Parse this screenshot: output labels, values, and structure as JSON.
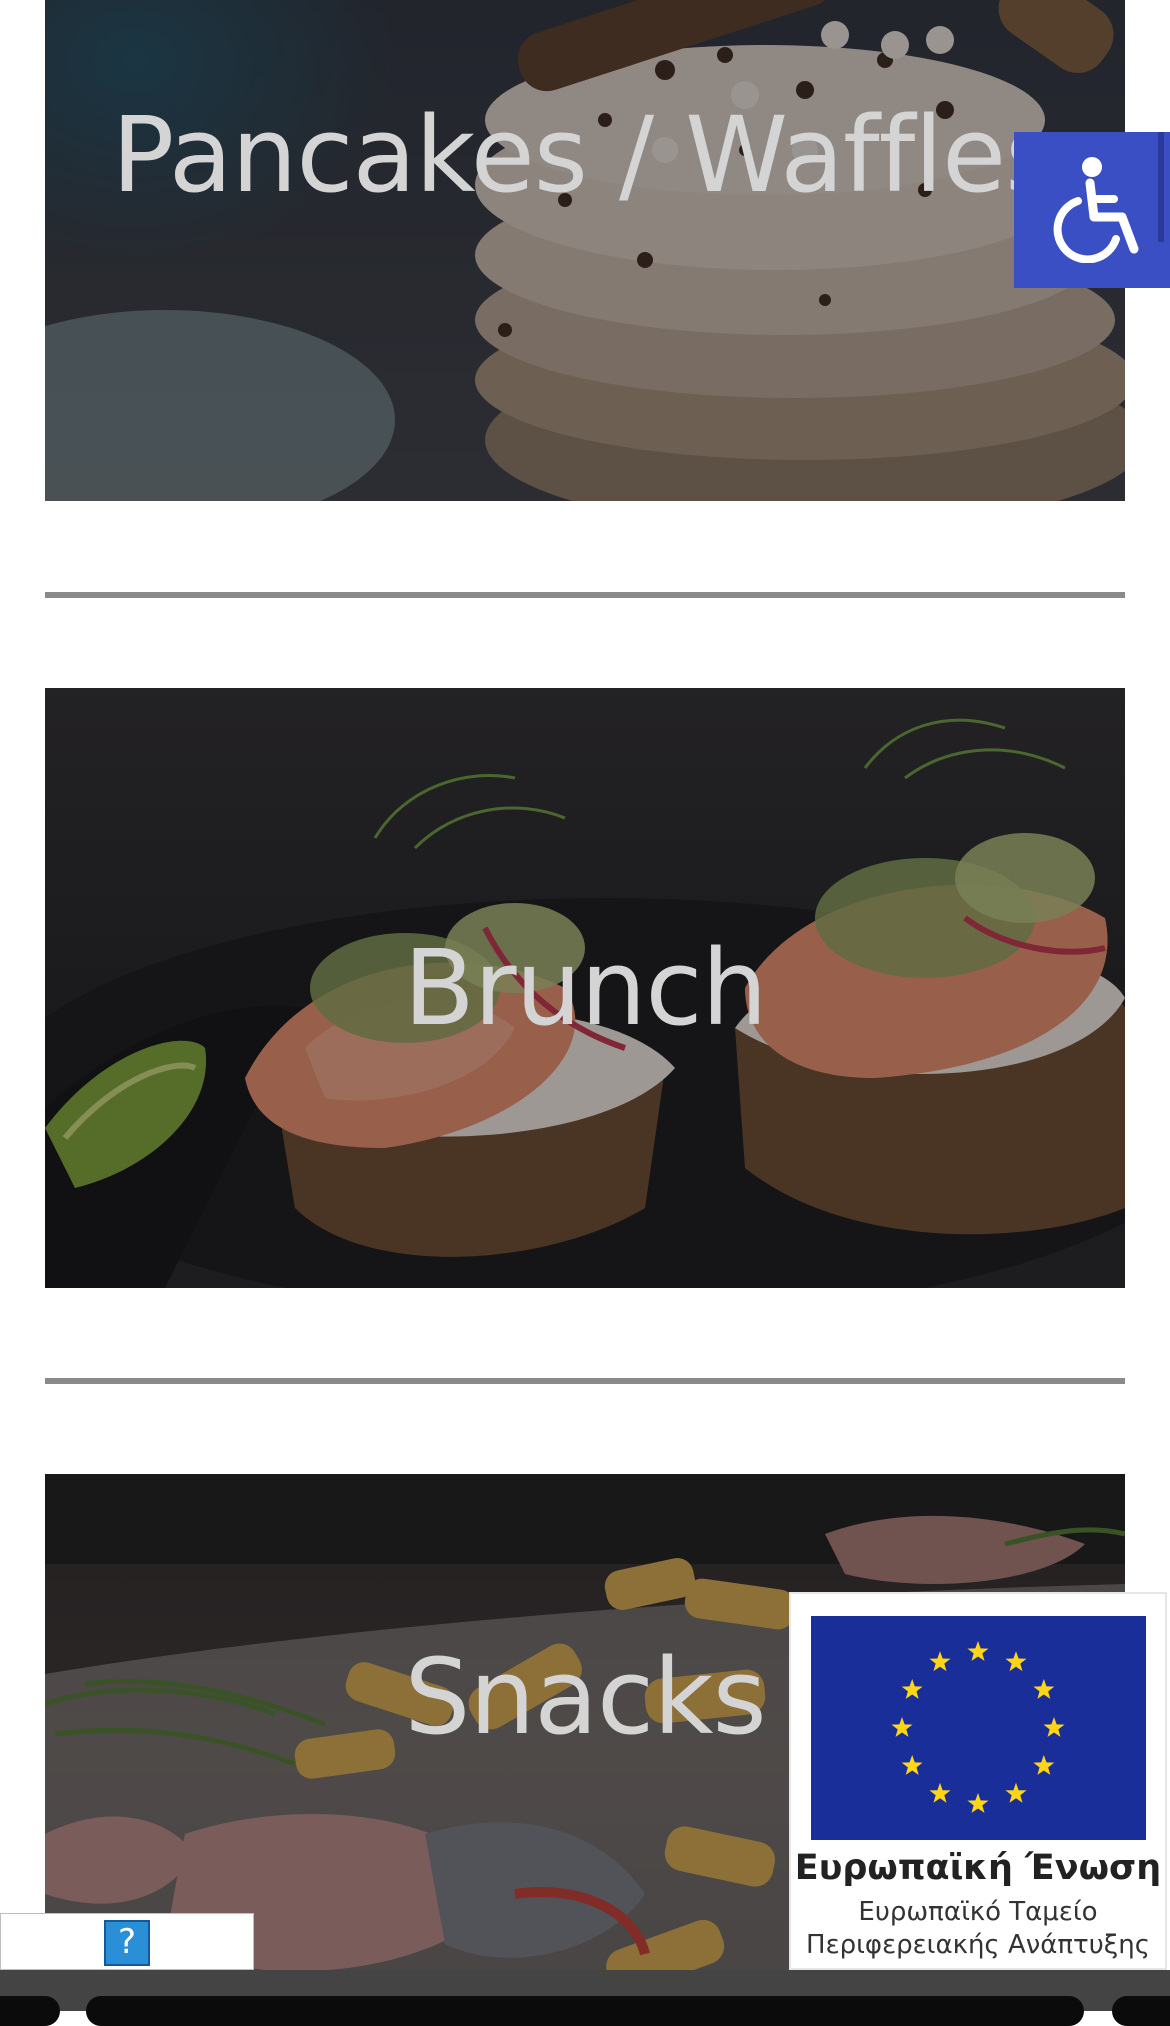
{
  "categories": [
    {
      "id": "pancakes",
      "label": "Pancakes / Waffles"
    },
    {
      "id": "brunch",
      "label": "Brunch"
    },
    {
      "id": "snacks",
      "label": "Snacks"
    }
  ],
  "icons": {
    "accessibility": "wheelchair-icon",
    "help": "question-mark-icon"
  },
  "eu_badge": {
    "title": "Ευρωπαϊκή Ένωση",
    "line1": "Ευρωπαϊκό Ταμείο",
    "line2": "Περιφερειακής Ανάπτυξης"
  },
  "help_widget": {
    "label": "?"
  },
  "colors": {
    "accessibility_button": "#3a4fc4",
    "eu_flag": "#1a2e9a",
    "eu_star": "#ffd617",
    "divider": "#8a8a8a",
    "title_text": "#d4d4d4",
    "help_button": "#2a8fd6"
  }
}
